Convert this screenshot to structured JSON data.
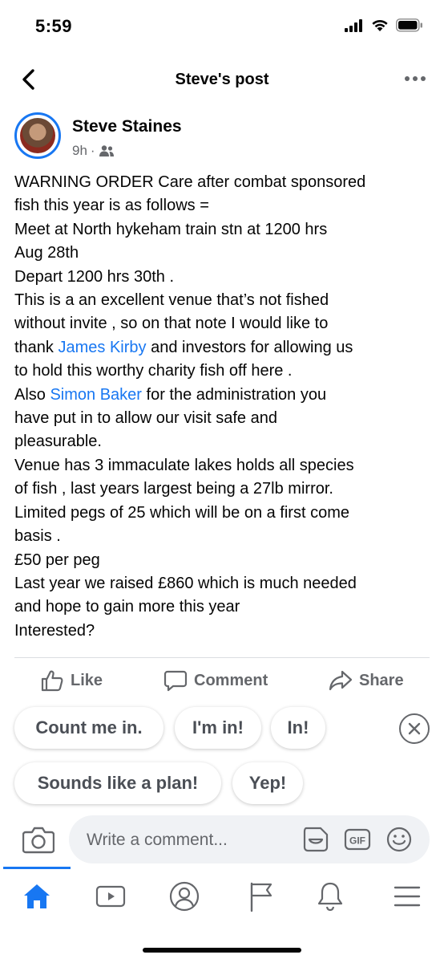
{
  "status_bar": {
    "time": "5:59"
  },
  "navbar": {
    "title": "Steve's post"
  },
  "post": {
    "author": "Steve Staines",
    "time": "9h",
    "separator": "·",
    "lines": {
      "l1": "WARNING ORDER Care after combat sponsored",
      "l2": "fish this year is as follows =",
      "l3": "Meet at North hykeham train stn at 1200 hrs",
      "l4": "Aug 28th",
      "l5": "Depart 1200 hrs 30th .",
      "l6": "This is a an excellent venue that’s not fished",
      "l7": "without invite , so on that note I would like to",
      "l8_pre": "thank ",
      "l8_mention": "James Kirby",
      "l8_post": " and investors for allowing us",
      "l9": "to hold this worthy charity fish off here .",
      "l10_pre": "Also ",
      "l10_mention": "Simon Baker",
      "l10_post": " for the administration you",
      "l11": "have put in to allow our visit safe and",
      "l12": "pleasurable.",
      "l13": "Venue has 3 immaculate lakes holds all species",
      "l14": "of fish , last years largest being a 27lb mirror.",
      "l15": "Limited pegs of 25 which will be on a first come",
      "l16": "basis .",
      "l17": "£50 per peg",
      "l18": "Last year we raised £860 which is much needed",
      "l19": "and hope to gain more this year",
      "l20": "Interested?"
    }
  },
  "actions": {
    "like": "Like",
    "comment": "Comment",
    "share": "Share"
  },
  "quick_replies": {
    "r1": "Count me in.",
    "r2": "I'm in!",
    "r3": "In!",
    "r4": "Sounds like a plan!",
    "r5": "Yep!"
  },
  "comment_box": {
    "placeholder": "Write a comment...",
    "gif_label": "GIF"
  },
  "colors": {
    "accent": "#1877f2",
    "secondary_text": "#65676b"
  },
  "icons": [
    "chevron-left-icon",
    "more-dots-icon",
    "friends-icon",
    "like-icon",
    "comment-icon",
    "share-icon",
    "close-icon",
    "camera-icon",
    "sticker-icon",
    "gif-icon",
    "emoji-icon",
    "home-icon",
    "watch-icon",
    "profile-icon",
    "pages-icon",
    "bell-icon",
    "menu-icon"
  ]
}
